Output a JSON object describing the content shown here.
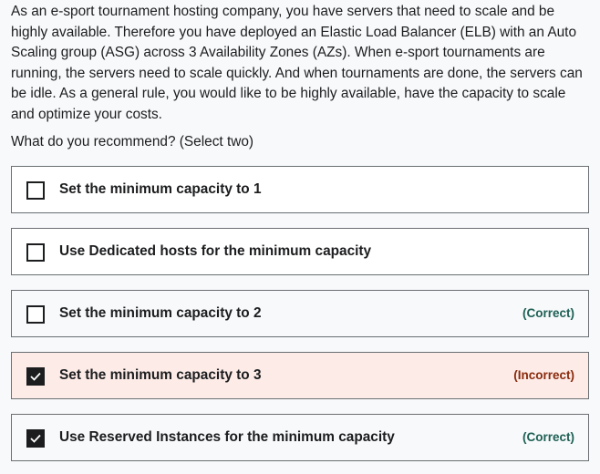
{
  "question": {
    "text": "As an e-sport tournament hosting company, you have servers that need to scale and be highly available. Therefore you have deployed an Elastic Load Balancer (ELB) with an Auto Scaling group (ASG) across 3 Availability Zones (AZs). When e-sport tournaments are running, the servers need to scale quickly. And when tournaments are done, the servers can be idle. As a general rule, you would like to be highly available, have the capacity to scale and optimize your costs.",
    "prompt": "What do you recommend? (Select two)"
  },
  "options": [
    {
      "label": "Set the minimum capacity to 1",
      "checked": false,
      "verdict": ""
    },
    {
      "label": "Use Dedicated hosts for the minimum capacity",
      "checked": false,
      "verdict": ""
    },
    {
      "label": "Set the minimum capacity to 2",
      "checked": false,
      "verdict": "(Correct)"
    },
    {
      "label": "Set the minimum capacity to 3",
      "checked": true,
      "verdict": "(Incorrect)"
    },
    {
      "label": "Use Reserved Instances for the minimum capacity",
      "checked": true,
      "verdict": "(Correct)"
    }
  ],
  "colors": {
    "text": "#1c1d1f",
    "border": "#6a6f73",
    "correct": "#1e6055",
    "incorrect": "#8a2a0c",
    "incorrect_bg": "#fcebe7"
  },
  "icons": {
    "checkbox_checked": "checkmark-icon"
  }
}
